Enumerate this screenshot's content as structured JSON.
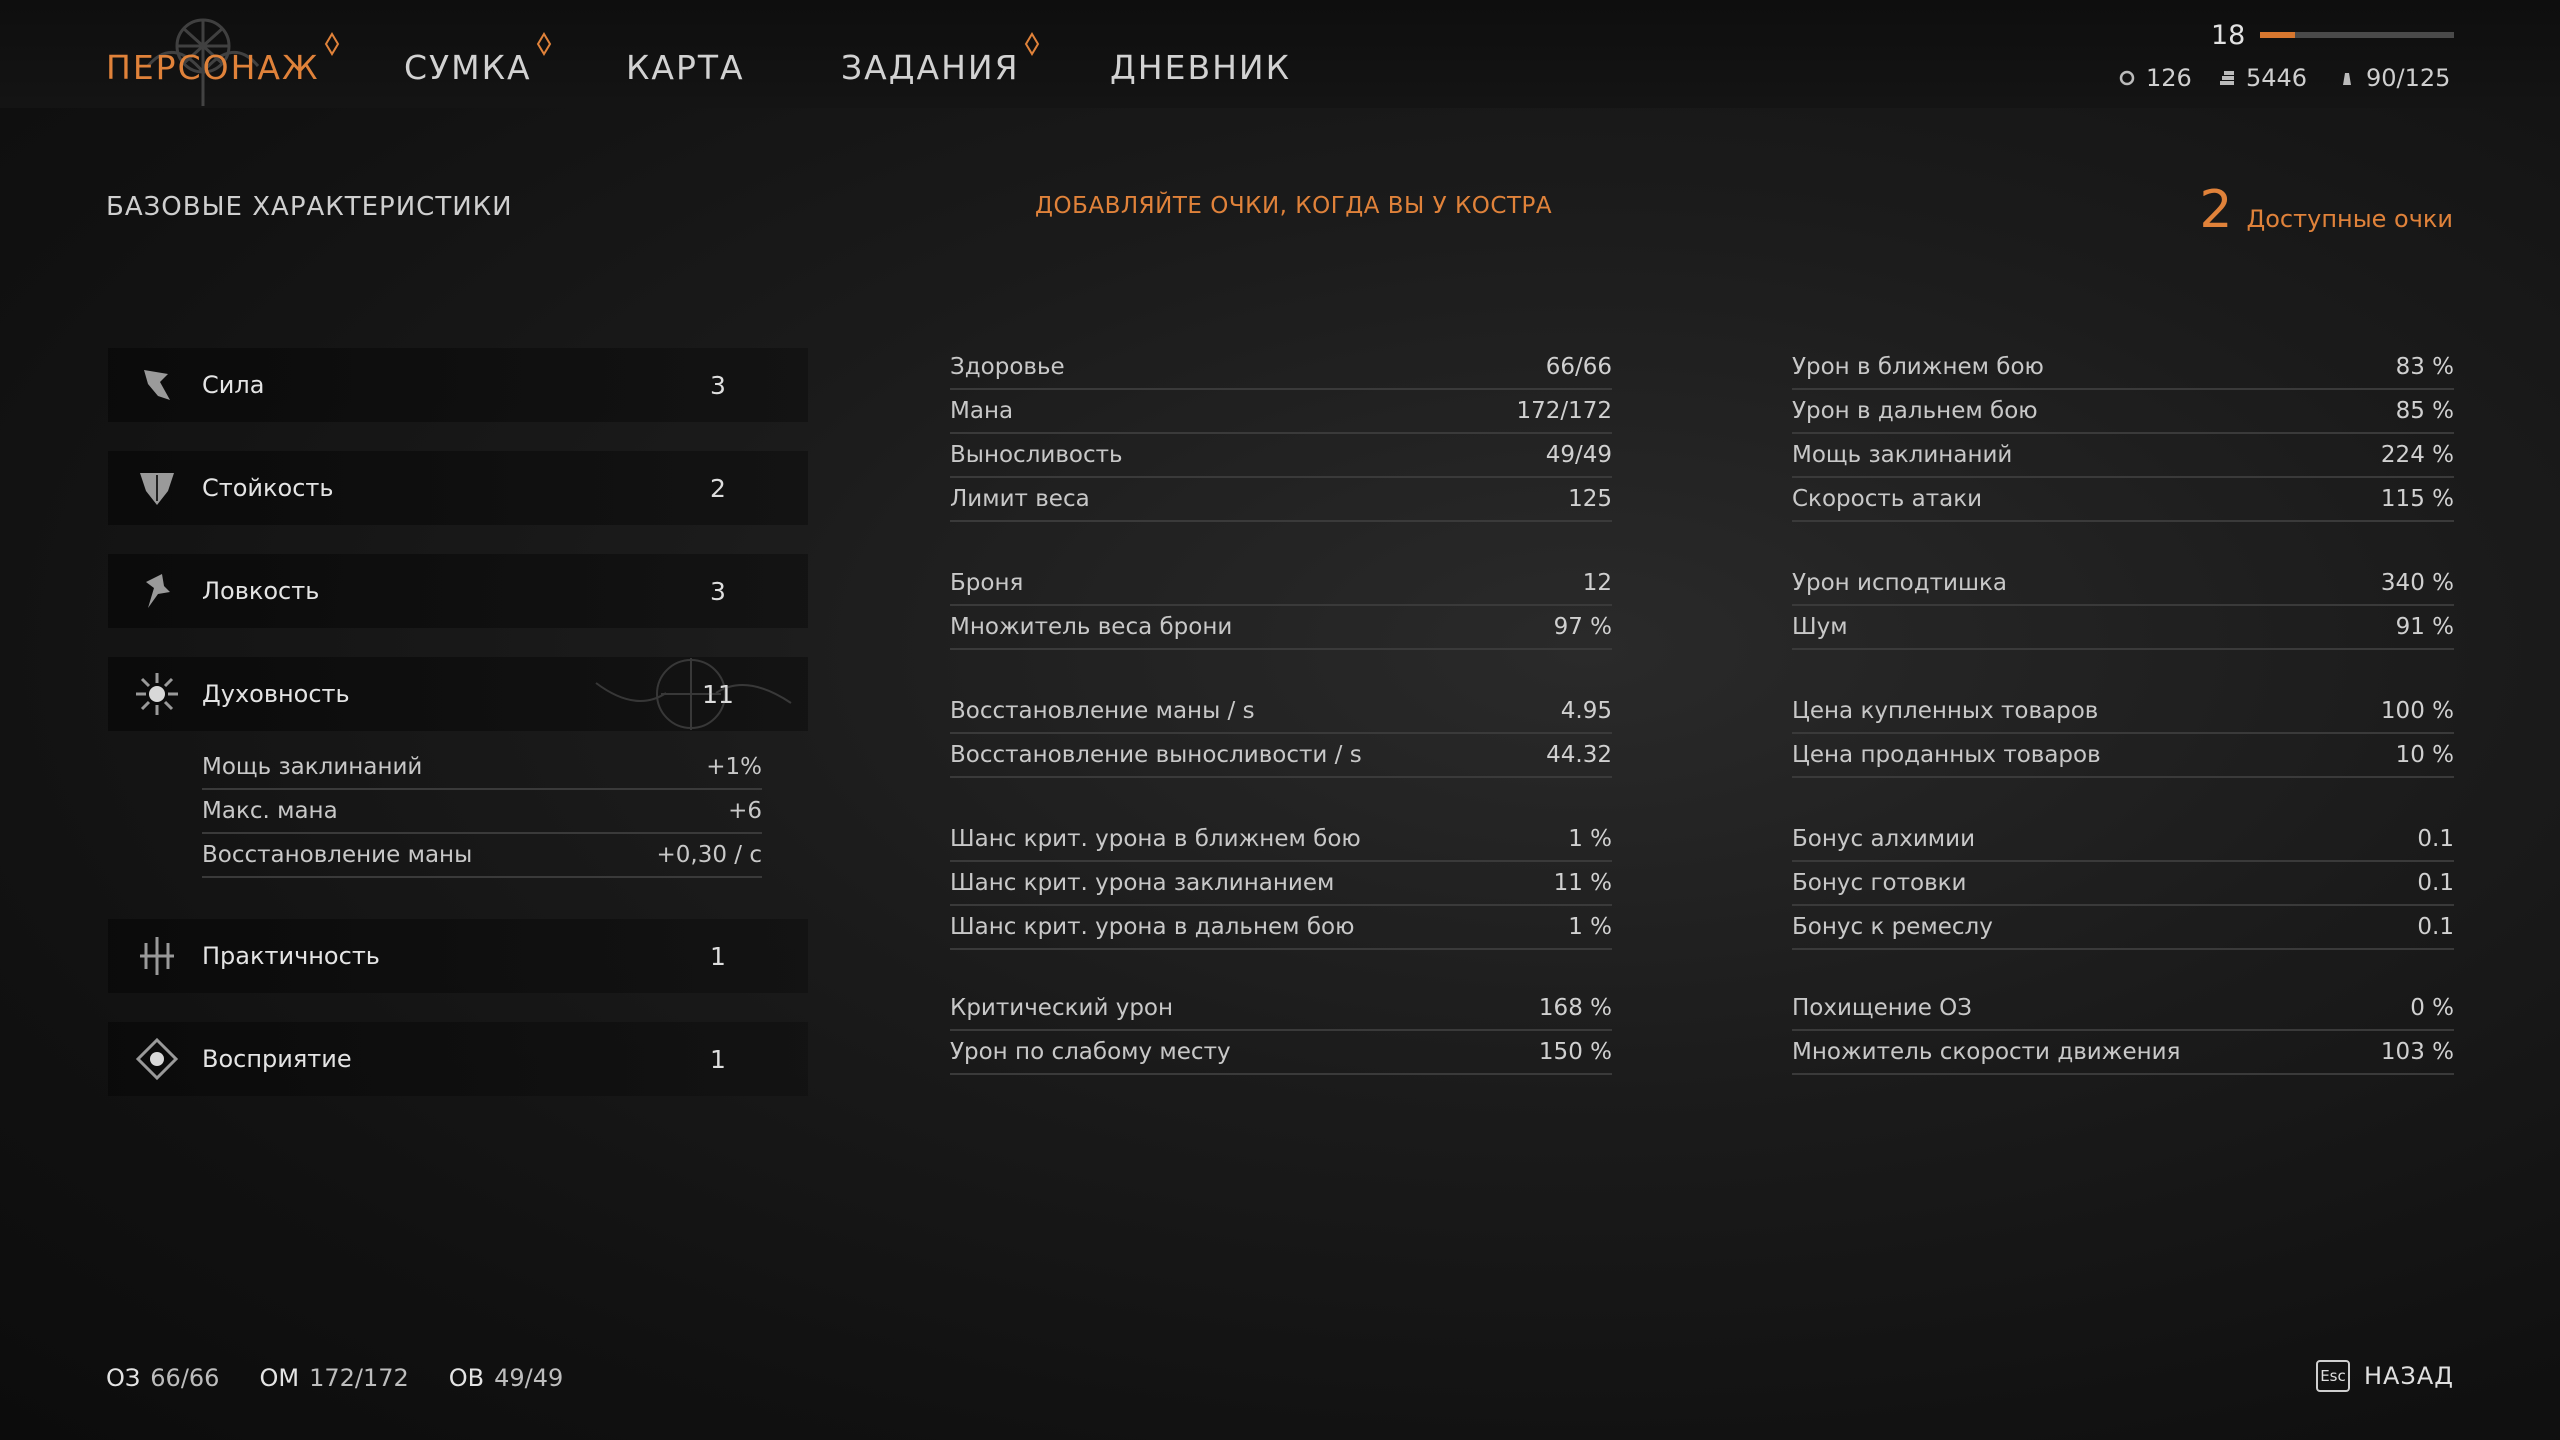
{
  "tabs": [
    {
      "label": "ПЕРСОНАЖ",
      "active": true,
      "badge": true
    },
    {
      "label": "СУМКА",
      "active": false,
      "badge": true
    },
    {
      "label": "КАРТА",
      "active": false,
      "badge": false
    },
    {
      "label": "ЗАДАНИЯ",
      "active": false,
      "badge": true
    },
    {
      "label": "ДНЕВНИК",
      "active": false,
      "badge": false
    }
  ],
  "header": {
    "level": "18",
    "xp_fraction": 0.18,
    "resources": [
      {
        "icon": "coin-icon",
        "value": "126"
      },
      {
        "icon": "gold-stack-icon",
        "value": "5446"
      },
      {
        "icon": "weight-icon",
        "value": "90/125"
      }
    ]
  },
  "section": {
    "title": "БАЗОВЫЕ ХАРАКТЕРИСТИКИ",
    "hint": "ДОБАВЛЯЙТЕ ОЧКИ, КОГДА ВЫ У КОСТРА",
    "points_value": "2",
    "points_label": "Доступные очки"
  },
  "attributes": [
    {
      "icon": "strength-icon",
      "name": "Сила",
      "value": "3"
    },
    {
      "icon": "toughness-icon",
      "name": "Стойкость",
      "value": "2"
    },
    {
      "icon": "agility-icon",
      "name": "Ловкость",
      "value": "3"
    },
    {
      "icon": "spirituality-icon",
      "name": "Духовность",
      "value": "11"
    },
    {
      "icon": "practicality-icon",
      "name": "Практичность",
      "value": "1"
    },
    {
      "icon": "perception-icon",
      "name": "Восприятие",
      "value": "1"
    }
  ],
  "spirituality_details": [
    {
      "label": "Мощь заклинаний",
      "value": "+1%"
    },
    {
      "label": "Макс. мана",
      "value": "+6"
    },
    {
      "label": "Восстановление маны",
      "value": "+0,30 / с"
    }
  ],
  "stats_left": [
    [
      {
        "label": "Здоровье",
        "value": "66/66"
      },
      {
        "label": "Мана",
        "value": "172/172"
      },
      {
        "label": "Выносливость",
        "value": "49/49"
      },
      {
        "label": "Лимит веса",
        "value": "125"
      }
    ],
    [
      {
        "label": "Броня",
        "value": "12"
      },
      {
        "label": "Множитель веса брони",
        "value": "97 %"
      }
    ],
    [
      {
        "label": "Восстановление маны / s",
        "value": "4.95"
      },
      {
        "label": "Восстановление выносливости / s",
        "value": "44.32"
      }
    ],
    [
      {
        "label": "Шанс крит. урона в ближнем бою",
        "value": "1 %"
      },
      {
        "label": "Шанс крит. урона заклинанием",
        "value": "11 %"
      },
      {
        "label": "Шанс крит. урона в дальнем бою",
        "value": "1 %"
      }
    ],
    [
      {
        "label": "Критический урон",
        "value": "168 %"
      },
      {
        "label": "Урон по слабому месту",
        "value": "150 %"
      }
    ]
  ],
  "stats_right": [
    [
      {
        "label": "Урон в ближнем бою",
        "value": "83 %"
      },
      {
        "label": "Урон в дальнем бою",
        "value": "85 %"
      },
      {
        "label": "Мощь заклинаний",
        "value": "224 %"
      },
      {
        "label": "Скорость атаки",
        "value": "115 %"
      }
    ],
    [
      {
        "label": "Урон исподтишка",
        "value": "340 %"
      },
      {
        "label": "Шум",
        "value": "91 %"
      }
    ],
    [
      {
        "label": "Цена купленных товаров",
        "value": "100 %"
      },
      {
        "label": "Цена проданных товаров",
        "value": "10 %"
      }
    ],
    [
      {
        "label": "Бонус алхимии",
        "value": "0.1"
      },
      {
        "label": "Бонус готовки",
        "value": "0.1"
      },
      {
        "label": "Бонус к ремеслу",
        "value": "0.1"
      }
    ],
    [
      {
        "label": "Похищение ОЗ",
        "value": "0 %"
      },
      {
        "label": "Множитель скорости движения",
        "value": "103 %"
      }
    ]
  ],
  "footer": {
    "hp_label": "ОЗ",
    "hp_value": "66/66",
    "mp_label": "ОМ",
    "mp_value": "172/172",
    "sp_label": "ОВ",
    "sp_value": "49/49",
    "back_key": "Esc",
    "back_label": "НАЗАД"
  },
  "colors": {
    "accent": "#e0823a",
    "divider": "#3a3a3a"
  }
}
